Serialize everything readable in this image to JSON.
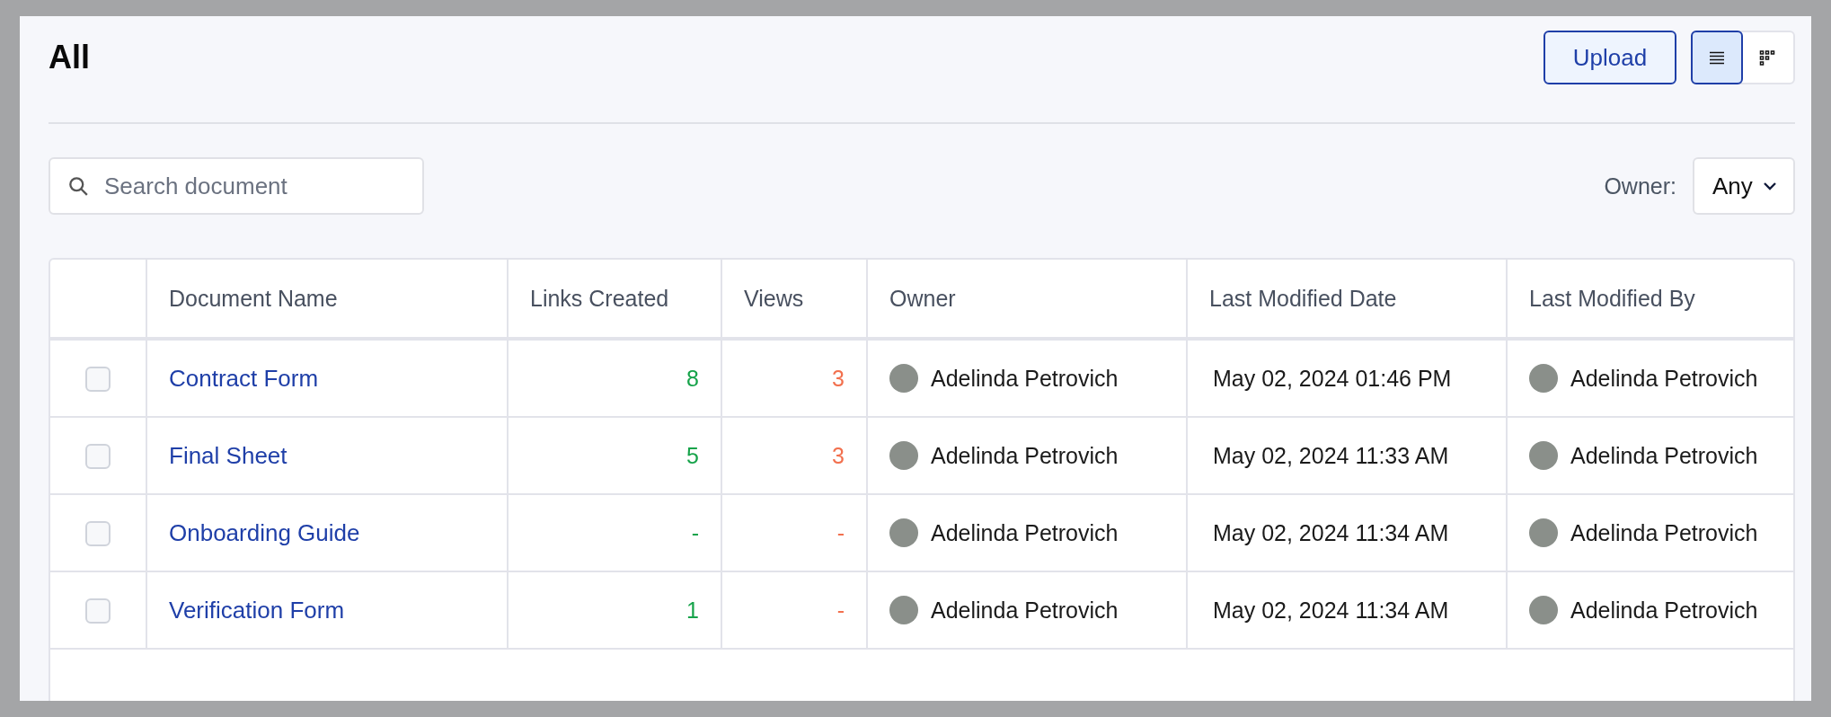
{
  "header": {
    "title": "All",
    "upload_button": "Upload",
    "view_modes": [
      {
        "kind": "list",
        "selected": true
      },
      {
        "kind": "grid",
        "selected": false
      }
    ]
  },
  "filters": {
    "search": {
      "placeholder": "Search document"
    },
    "owner_label": "Owner:",
    "owner_value": "Any"
  },
  "table": {
    "columns": [
      "Document Name",
      "Links Created",
      "Views",
      "Owner",
      "Last Modified Date",
      "Last Modified By"
    ],
    "rows": [
      {
        "checked": false,
        "name": "Contract Form",
        "links": "8",
        "views": "3",
        "owner": "Adelinda Petrovich",
        "modified": "May 02, 2024 01:46 PM",
        "modified_by": "Adelinda Petrovich"
      },
      {
        "checked": false,
        "name": "Final Sheet",
        "links": "5",
        "views": "3",
        "owner": "Adelinda Petrovich",
        "modified": "May 02, 2024 11:33 AM",
        "modified_by": "Adelinda Petrovich"
      },
      {
        "checked": false,
        "name": "Onboarding Guide",
        "links": "-",
        "views": "-",
        "owner": "Adelinda Petrovich",
        "modified": "May 02, 2024 11:34 AM",
        "modified_by": "Adelinda Petrovich"
      },
      {
        "checked": false,
        "name": "Verification Form",
        "links": "1",
        "views": "-",
        "owner": "Adelinda Petrovich",
        "modified": "May 02, 2024 11:34 AM",
        "modified_by": "Adelinda Petrovich"
      }
    ]
  }
}
